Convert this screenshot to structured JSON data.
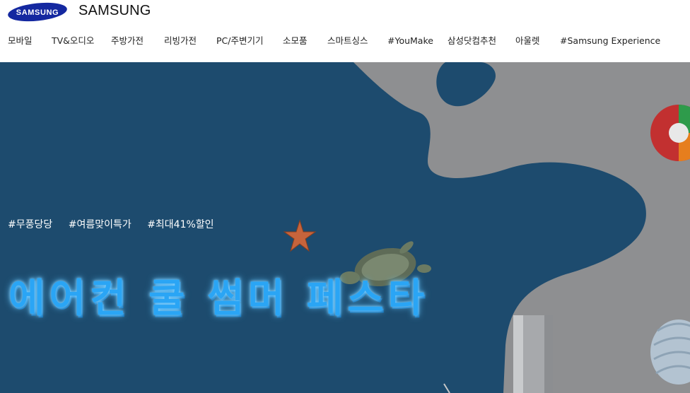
{
  "header": {
    "logo_text": "SAMSUNG",
    "brand_title": "SAMSUNG",
    "brand_color": "#1428a0"
  },
  "nav": {
    "items": [
      {
        "label": "모바일"
      },
      {
        "label": "TV&오디오"
      },
      {
        "label": "주방가전"
      },
      {
        "label": "리빙가전"
      },
      {
        "label": "PC/주변기기"
      },
      {
        "label": "소모품"
      },
      {
        "label": "스마트싱스"
      },
      {
        "label": "#YouMake"
      },
      {
        "label": "삼성닷컴추천"
      },
      {
        "label": "아울렛"
      },
      {
        "label": "#Samsung Experience"
      }
    ]
  },
  "hero": {
    "hashtags": [
      "#무풍당당",
      "#여름맞이특가",
      "#최대41%할인"
    ],
    "headline": "에어컨 쿨 썸머 페스타",
    "background_color": "#1d4b6e",
    "wave_color": "#8e8f91",
    "headline_color": "#2aa5f5"
  }
}
